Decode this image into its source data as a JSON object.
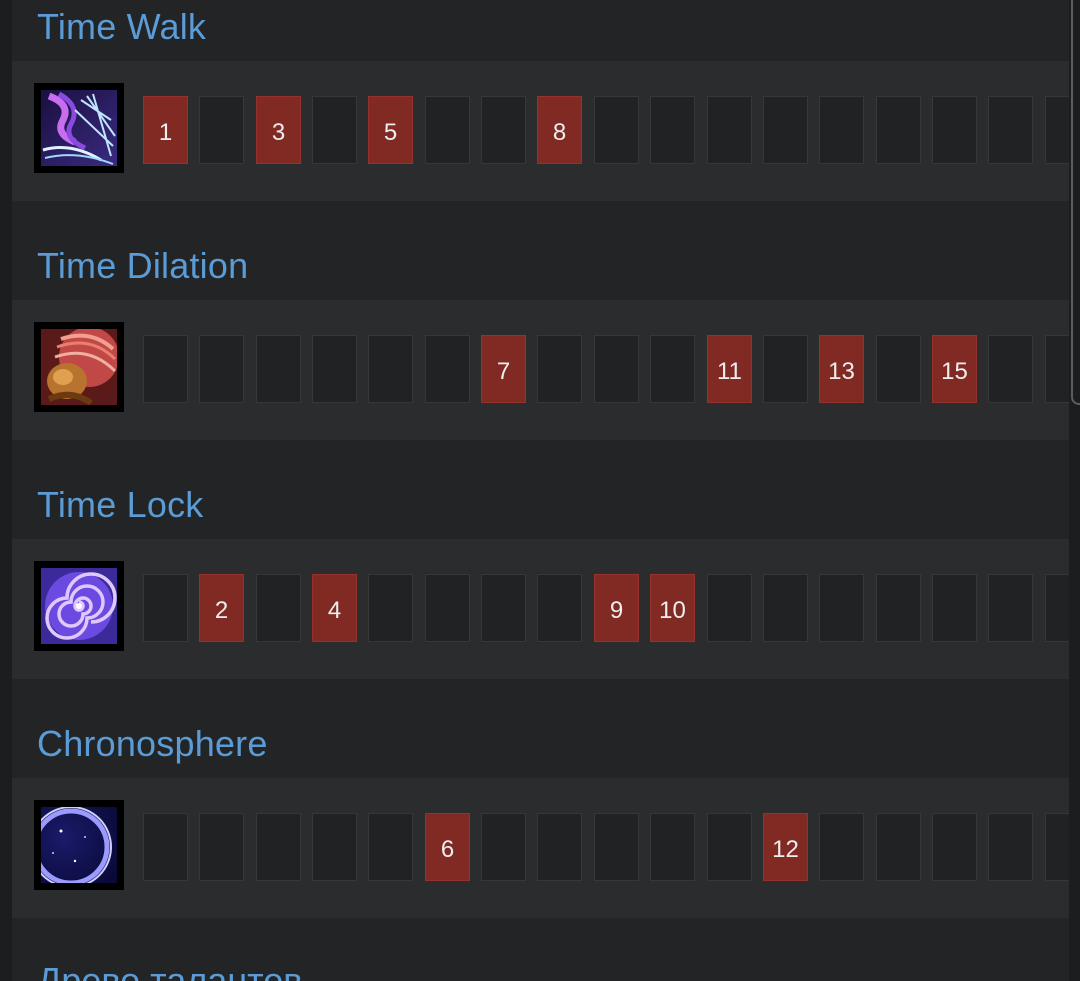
{
  "abilities": [
    {
      "name": "Time Walk",
      "icon": "time-walk-icon",
      "levels": [
        "1",
        "",
        "3",
        "",
        "5",
        "",
        "",
        "8",
        "",
        "",
        "",
        "",
        "",
        "",
        "",
        "",
        "",
        ""
      ]
    },
    {
      "name": "Time Dilation",
      "icon": "time-dilation-icon",
      "levels": [
        "",
        "",
        "",
        "",
        "",
        "",
        "7",
        "",
        "",
        "",
        "11",
        "",
        "13",
        "",
        "15",
        "",
        "",
        ""
      ]
    },
    {
      "name": "Time Lock",
      "icon": "time-lock-icon",
      "levels": [
        "",
        "2",
        "",
        "4",
        "",
        "",
        "",
        "",
        "9",
        "10",
        "",
        "",
        "",
        "",
        "",
        "",
        "",
        ""
      ]
    },
    {
      "name": "Chronosphere",
      "icon": "chronosphere-icon",
      "levels": [
        "",
        "",
        "",
        "",
        "",
        "6",
        "",
        "",
        "",
        "",
        "",
        "12",
        "",
        "",
        "",
        "",
        "",
        ""
      ]
    }
  ],
  "next_section_title": "Древо талантов",
  "colors": {
    "title": "#5b9bd6",
    "taken_level": "#812923",
    "empty_level": "#202224",
    "row_background": "#2a2c2e",
    "page_background": "#222426"
  }
}
